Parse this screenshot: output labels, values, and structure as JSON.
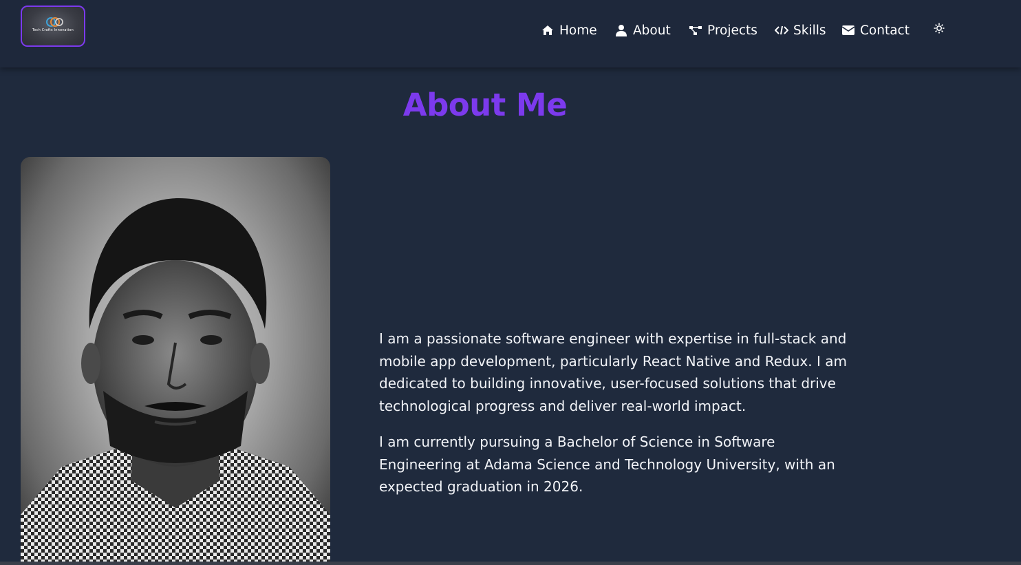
{
  "logo": {
    "text": "Tech Crafts Innovation"
  },
  "nav": {
    "items": [
      {
        "label": "Home",
        "icon": "home-icon"
      },
      {
        "label": "About",
        "icon": "user-icon"
      },
      {
        "label": "Projects",
        "icon": "project-diagram-icon"
      },
      {
        "label": "Skills",
        "icon": "code-icon"
      },
      {
        "label": "Contact",
        "icon": "envelope-icon"
      }
    ],
    "theme_toggle_icon": "sun-icon"
  },
  "about": {
    "title": "About Me",
    "paragraphs": [
      "I am a passionate software engineer with expertise in full-stack and mobile app development, particularly React Native and Redux. I am dedicated to building innovative, user-focused solutions that drive technological progress and deliver real-world impact.",
      "I am currently pursuing a Bachelor of Science in Software Engineering at Adama Science and Technology University, with an expected graduation in 2026."
    ]
  },
  "colors": {
    "background": "#1f2a3d",
    "accent": "#7c3aed",
    "text": "#ffffff"
  }
}
